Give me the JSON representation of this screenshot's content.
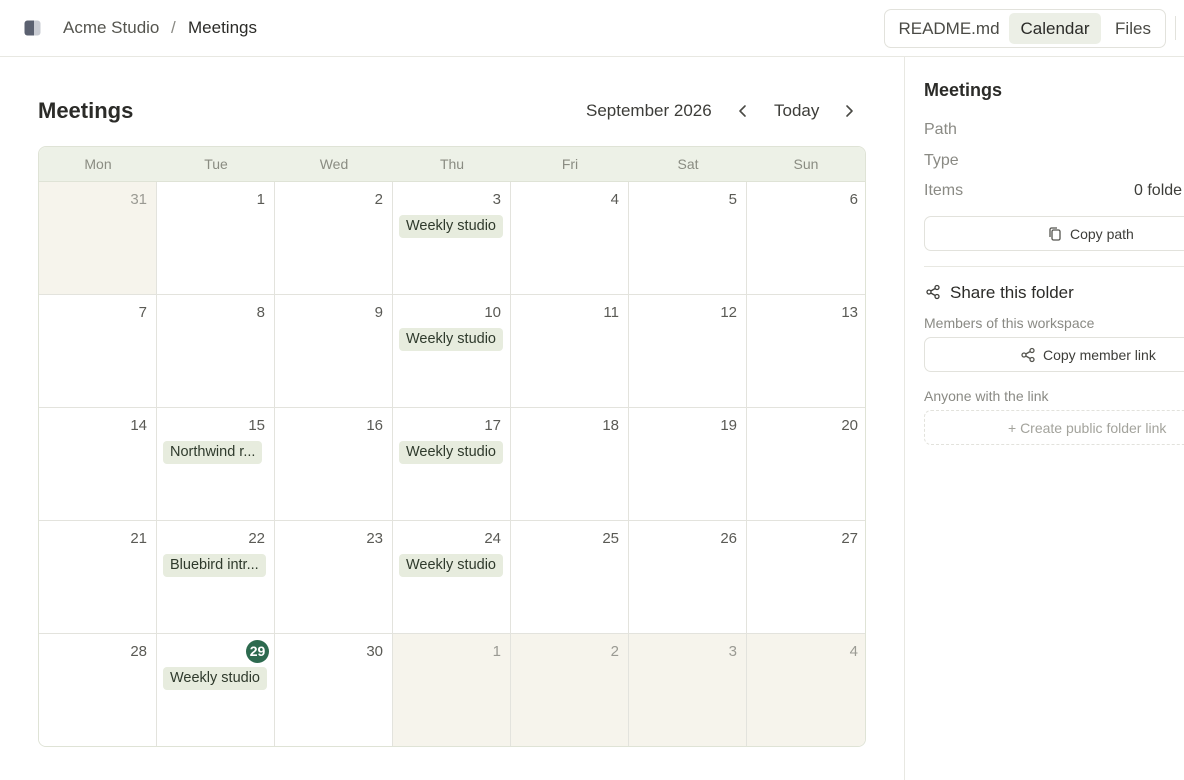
{
  "header": {
    "breadcrumb_root": "Acme Studio",
    "breadcrumb_separator": "/",
    "breadcrumb_current": "Meetings",
    "tabs": [
      {
        "label": "README.md",
        "active": false
      },
      {
        "label": "Calendar",
        "active": true
      },
      {
        "label": "Files",
        "active": false
      }
    ]
  },
  "main": {
    "title": "Meetings",
    "month_label": "September 2026",
    "today_label": "Today",
    "weekdays": [
      "Mon",
      "Tue",
      "Wed",
      "Thu",
      "Fri",
      "Sat",
      "Sun"
    ],
    "weeks": [
      [
        {
          "day": "31",
          "in_month": false
        },
        {
          "day": "1",
          "in_month": true
        },
        {
          "day": "2",
          "in_month": true
        },
        {
          "day": "3",
          "in_month": true,
          "event": "Weekly studio"
        },
        {
          "day": "4",
          "in_month": true
        },
        {
          "day": "5",
          "in_month": true
        },
        {
          "day": "6",
          "in_month": true
        }
      ],
      [
        {
          "day": "7",
          "in_month": true
        },
        {
          "day": "8",
          "in_month": true
        },
        {
          "day": "9",
          "in_month": true
        },
        {
          "day": "10",
          "in_month": true,
          "event": "Weekly studio"
        },
        {
          "day": "11",
          "in_month": true
        },
        {
          "day": "12",
          "in_month": true
        },
        {
          "day": "13",
          "in_month": true
        }
      ],
      [
        {
          "day": "14",
          "in_month": true
        },
        {
          "day": "15",
          "in_month": true,
          "event": "Northwind r..."
        },
        {
          "day": "16",
          "in_month": true
        },
        {
          "day": "17",
          "in_month": true,
          "event": "Weekly studio"
        },
        {
          "day": "18",
          "in_month": true
        },
        {
          "day": "19",
          "in_month": true
        },
        {
          "day": "20",
          "in_month": true
        }
      ],
      [
        {
          "day": "21",
          "in_month": true
        },
        {
          "day": "22",
          "in_month": true,
          "event": "Bluebird intr..."
        },
        {
          "day": "23",
          "in_month": true
        },
        {
          "day": "24",
          "in_month": true,
          "event": "Weekly studio"
        },
        {
          "day": "25",
          "in_month": true
        },
        {
          "day": "26",
          "in_month": true
        },
        {
          "day": "27",
          "in_month": true
        }
      ],
      [
        {
          "day": "28",
          "in_month": true
        },
        {
          "day": "29",
          "in_month": true,
          "today": true,
          "event": "Weekly studio"
        },
        {
          "day": "30",
          "in_month": true
        },
        {
          "day": "1",
          "in_month": false
        },
        {
          "day": "2",
          "in_month": false
        },
        {
          "day": "3",
          "in_month": false
        },
        {
          "day": "4",
          "in_month": false
        }
      ]
    ]
  },
  "sidebar": {
    "title": "Meetings",
    "path_label": "Path",
    "type_label": "Type",
    "items_label": "Items",
    "items_value": "0 folde",
    "copy_path_label": "Copy path",
    "share_title": "Share this folder",
    "members_label": "Members of this workspace",
    "copy_member_link_label": "Copy member link",
    "anyone_label": "Anyone with the link",
    "create_public_link_label": "+ Create public folder link"
  },
  "colors": {
    "accent": "#2d6a4f",
    "event_bg": "#e7ecde",
    "header_bg": "#edf1e7",
    "out_of_month_bg": "#f6f4ec"
  }
}
